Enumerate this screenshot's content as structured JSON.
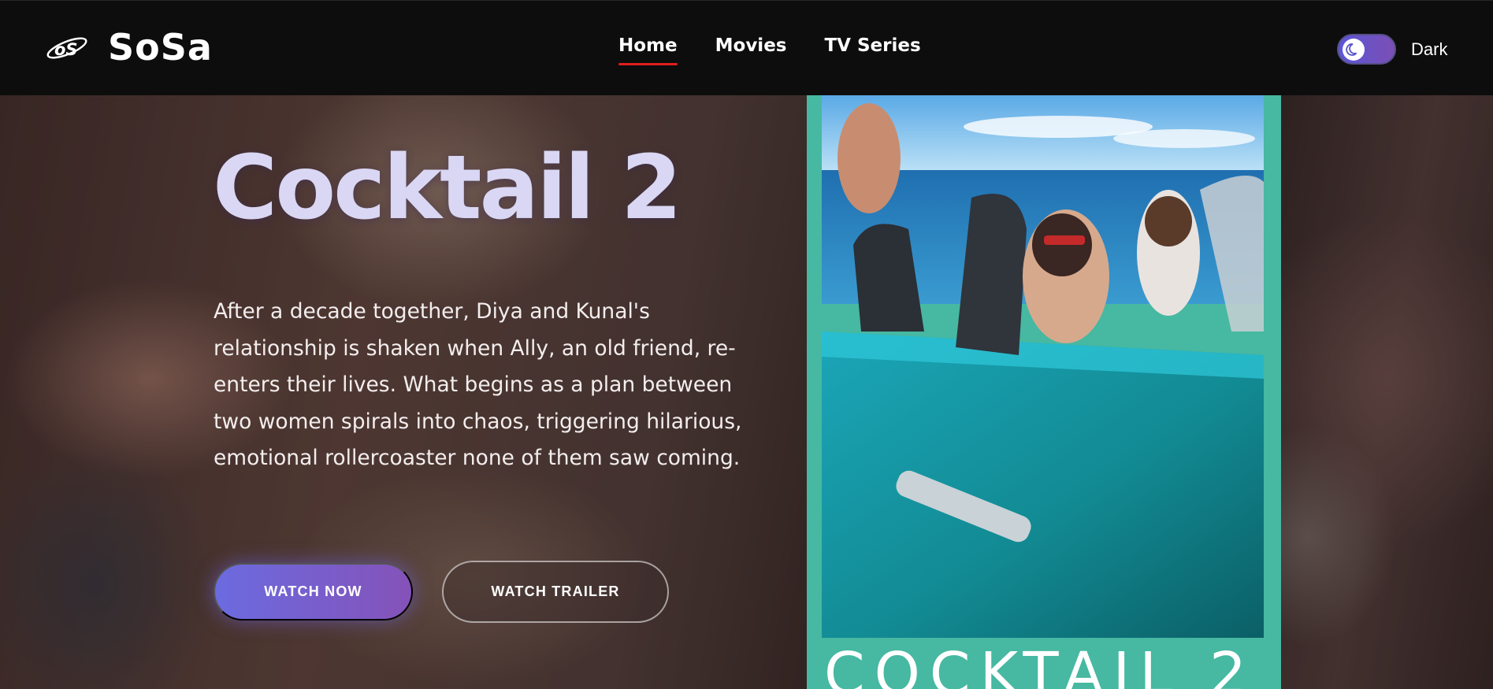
{
  "app": {
    "brand": "SoSa"
  },
  "nav": {
    "items": [
      {
        "label": "Home",
        "active": true
      },
      {
        "label": "Movies",
        "active": false
      },
      {
        "label": "TV Series",
        "active": false
      }
    ]
  },
  "theme": {
    "label": "Dark",
    "icon": "moon-icon",
    "enabled": true,
    "toggle_color": "#5b56d6"
  },
  "hero": {
    "title": "Cocktail 2",
    "description": "After a decade together, Diya and Kunal's relationship is shaken when Ally, an old friend, re-enters their lives. What begins as a plan between two women spirals into chaos, triggering hilarious, emotional rollercoaster none of them saw coming.",
    "watch_now_label": "WATCH NOW",
    "watch_trailer_label": "WATCH TRAILER",
    "title_color": "#d9d7f3"
  },
  "poster": {
    "title": "COCKTAIL 2",
    "frame_color": "#47b8a2"
  },
  "colors": {
    "accent_underline": "#e11d1d",
    "button_gradient_start": "#6b6be0",
    "button_gradient_end": "#8552b8"
  }
}
